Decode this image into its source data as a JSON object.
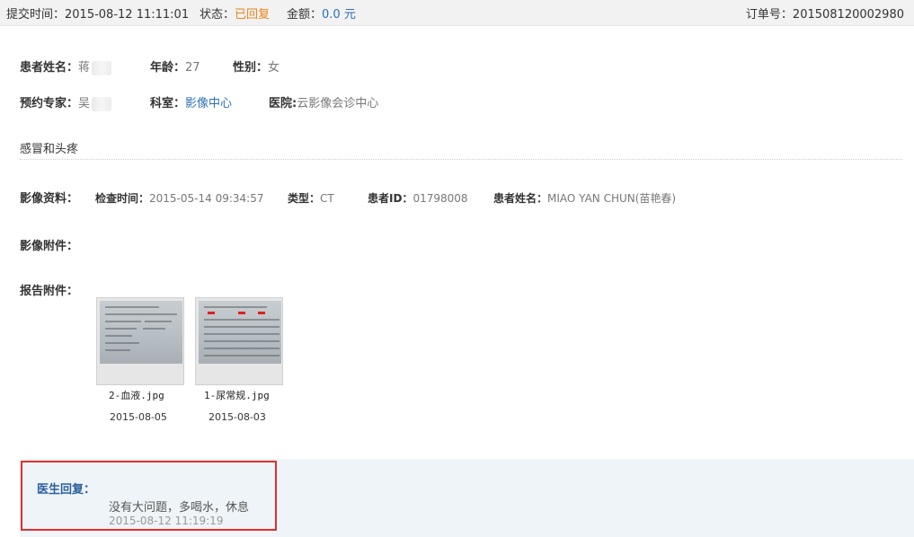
{
  "header": {
    "submit_label": "提交时间：",
    "submit_time": "2015-08-12 11:11:01",
    "status_label": "状态：",
    "status_value": "已回复",
    "amount_label": "金额：",
    "amount_value": "0.0 元",
    "order_label": "订单号：",
    "order_no": "201508120002980"
  },
  "patient": {
    "name_label": "患者姓名：",
    "name_value": "蒋",
    "age_label": "年龄：",
    "age_value": "27",
    "gender_label": "性别：",
    "gender_value": "女",
    "expert_label": "预约专家：",
    "expert_value": "吴",
    "dept_label": "科室：",
    "dept_value": "影像中心",
    "hospital_label": "医院:",
    "hospital_value": "云影像会诊中心"
  },
  "complaint": "感冒和头疼",
  "imaging": {
    "label": "影像资料：",
    "exam_time_label": "检查时间：",
    "exam_time_value": "2015-05-14 09:34:57",
    "type_label": "类型：",
    "type_value": "CT",
    "patient_id_label": "患者ID：",
    "patient_id_value": "01798008",
    "patient_name_label": "患者姓名：",
    "patient_name_value": "MIAO YAN CHUN(苗艳春)"
  },
  "imaging_attachments": {
    "label": "影像附件："
  },
  "report_attachments": {
    "label": "报告附件：",
    "files": [
      {
        "name": "2-血液.jpg",
        "date": "2015-08-05"
      },
      {
        "name": "1-尿常规.jpg",
        "date": "2015-08-03"
      }
    ]
  },
  "doctor_reply": {
    "label": "医生回复：",
    "text": "没有大问题，多喝水，休息",
    "time": "2015-08-12 11:19:19"
  },
  "colors": {
    "status_orange": "#e8841a",
    "link_blue": "#2a6fb5",
    "highlight_red": "#e03030",
    "reply_bg": "#eef4f7"
  }
}
